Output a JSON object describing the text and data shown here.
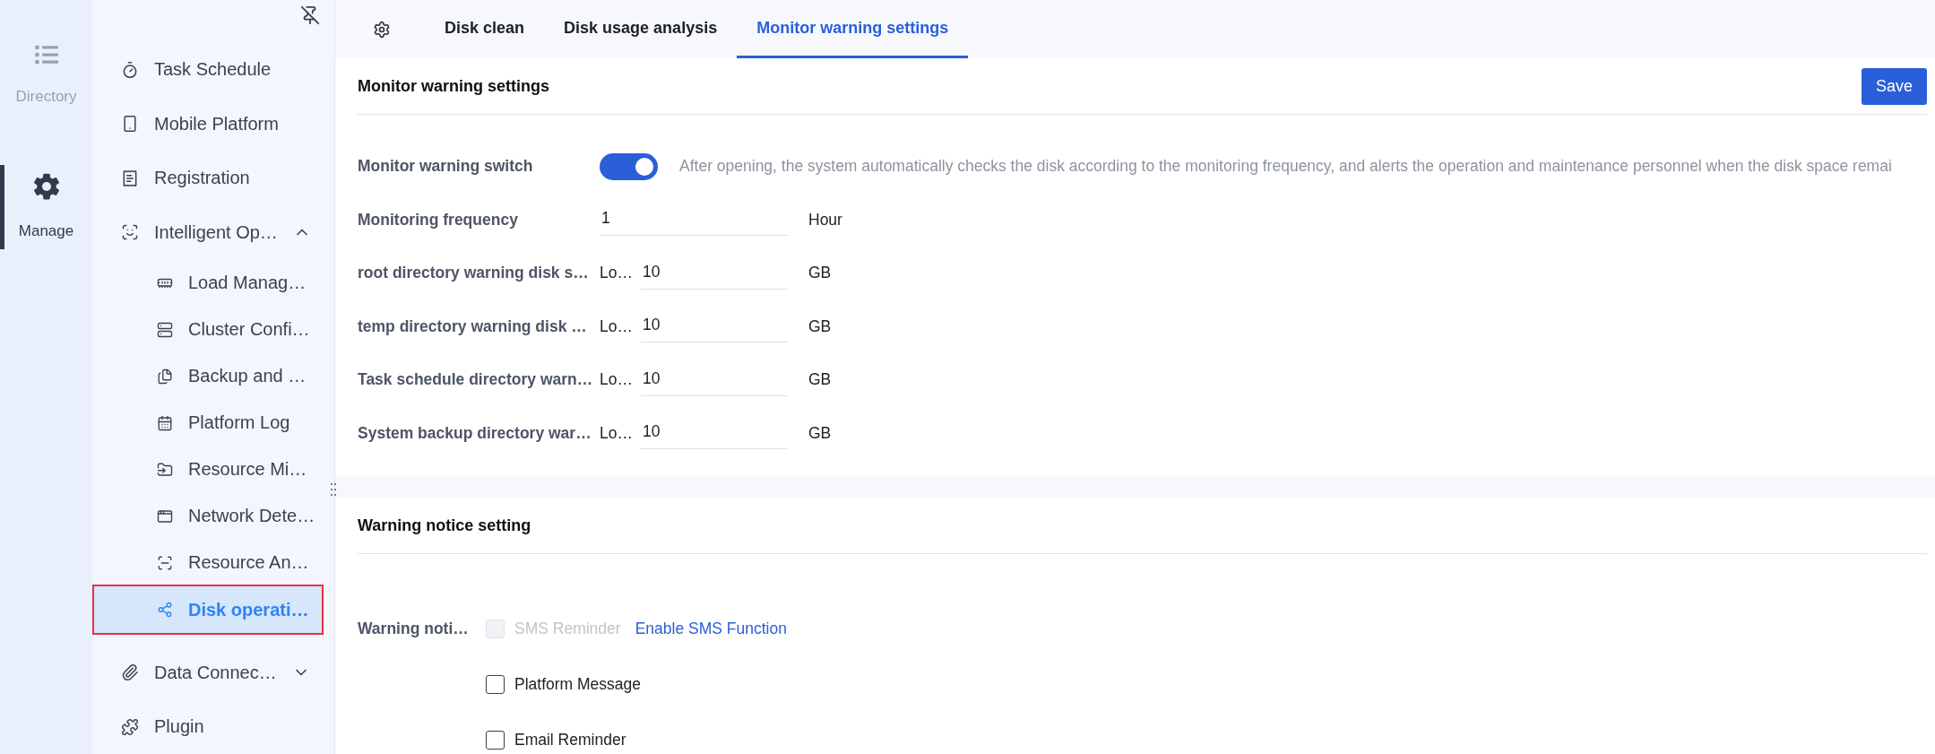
{
  "rail": [
    {
      "label": "Directory",
      "selected": false
    },
    {
      "label": "Manage",
      "selected": true
    }
  ],
  "sidebar": {
    "items": [
      {
        "label": "Task Schedule",
        "selected": false
      },
      {
        "label": "Mobile Platform",
        "selected": false
      },
      {
        "label": "Registration",
        "selected": false
      },
      {
        "label": "Intelligent Op…",
        "selected": false,
        "expanded": true,
        "children": [
          {
            "label": "Load Manag…",
            "selected": false
          },
          {
            "label": "Cluster Confi…",
            "selected": false
          },
          {
            "label": "Backup and …",
            "selected": false
          },
          {
            "label": "Platform Log",
            "selected": false
          },
          {
            "label": "Resource Mi…",
            "selected": false
          },
          {
            "label": "Network Dete…",
            "selected": false
          },
          {
            "label": "Resource An…",
            "selected": false
          },
          {
            "label": "Disk operati…",
            "selected": true
          }
        ]
      },
      {
        "label": "Data Connec…",
        "selected": false,
        "expanded": false
      },
      {
        "label": "Plugin",
        "selected": false
      }
    ]
  },
  "tabs": [
    {
      "label": "Disk clean",
      "selected": false
    },
    {
      "label": "Disk usage analysis",
      "selected": false
    },
    {
      "label": "Monitor warning settings",
      "selected": true
    }
  ],
  "monitor": {
    "title": "Monitor warning settings",
    "save": "Save",
    "switch": {
      "label": "Monitor warning switch",
      "on": true,
      "description": "After opening, the system automatically checks the disk according to the monitoring frequency, and alerts the operation and maintenance personnel when the disk space remai"
    },
    "rows": [
      {
        "label": "Monitoring frequency",
        "value": "1",
        "unit": "Hour"
      },
      {
        "label": "root directory warning disk s…",
        "prefix": "Lo…",
        "value": "10",
        "unit": "GB"
      },
      {
        "label": "temp directory warning disk …",
        "prefix": "Lo…",
        "value": "10",
        "unit": "GB"
      },
      {
        "label": "Task schedule directory warn…",
        "prefix": "Lo…",
        "value": "10",
        "unit": "GB"
      },
      {
        "label": "System backup directory war…",
        "prefix": "Lo…",
        "value": "10",
        "unit": "GB"
      }
    ]
  },
  "notice": {
    "title": "Warning notice setting",
    "label": "Warning noti…",
    "options": [
      {
        "label": "SMS Reminder",
        "checked": false,
        "disabled": true,
        "link": "Enable SMS Function"
      },
      {
        "label": "Platform Message",
        "checked": false,
        "disabled": false
      },
      {
        "label": "Email Reminder",
        "checked": false,
        "disabled": false
      }
    ]
  }
}
